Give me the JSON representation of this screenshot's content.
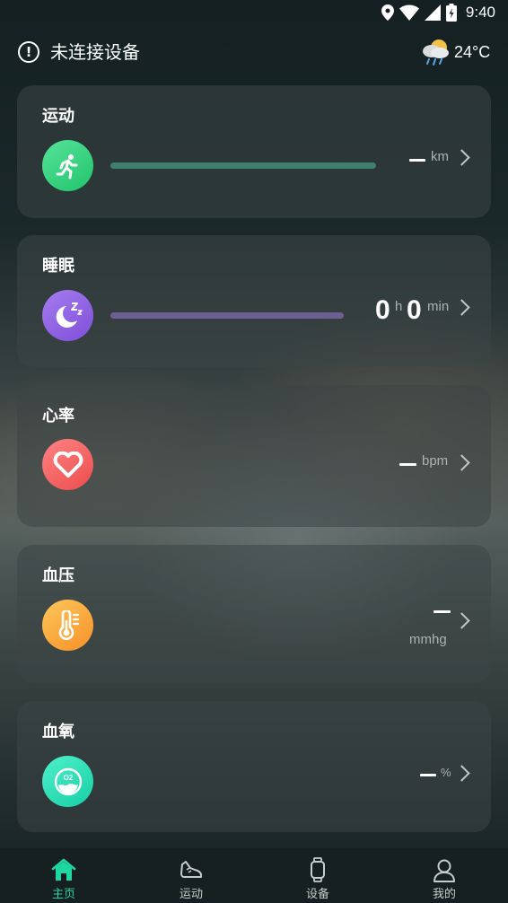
{
  "status_bar": {
    "time": "9:40"
  },
  "header": {
    "connection_text": "未连接设备",
    "temperature": "24°C"
  },
  "cards": {
    "exercise": {
      "title": "运动",
      "value": "—",
      "unit": "km",
      "progress": 0
    },
    "sleep": {
      "title": "睡眠",
      "hours": "0",
      "hours_unit": "h",
      "minutes": "0",
      "minutes_unit": "min",
      "progress": 0
    },
    "heart_rate": {
      "title": "心率",
      "value": "—",
      "unit": "bpm"
    },
    "blood_pressure": {
      "title": "血压",
      "value": "—",
      "unit": "mmhg"
    },
    "blood_oxygen": {
      "title": "血氧",
      "value": "—",
      "unit": "%",
      "icon_text": "O2"
    }
  },
  "nav": {
    "items": [
      {
        "label": "主页",
        "icon": "home-icon"
      },
      {
        "label": "运动",
        "icon": "shoe-icon"
      },
      {
        "label": "设备",
        "icon": "watch-icon"
      },
      {
        "label": "我的",
        "icon": "person-icon"
      }
    ],
    "active": 0
  },
  "colors": {
    "accent": "#20d7a4",
    "exercise": "#2ed47f",
    "sleep": "#8f62e0",
    "heart": "#f25b5b",
    "pressure": "#f7a33a",
    "oxygen": "#27ddb5",
    "exercise_bar": "#3f7f6c",
    "sleep_bar": "#6d5f92"
  }
}
